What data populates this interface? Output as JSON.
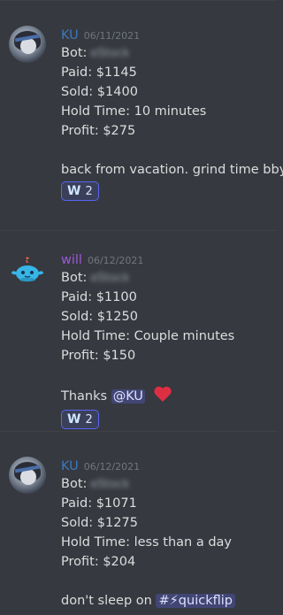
{
  "messages": [
    {
      "author": "KU",
      "timestamp": "06/11/2021",
      "lines": [
        "Bot:",
        "Paid: $1145",
        "Sold: $1400",
        "Hold Time: 10 minutes",
        "Profit: $275"
      ],
      "bot_redacted": "eStock",
      "note": "back from vacation. grind time bby",
      "reaction": {
        "emoji": "W",
        "count": "2"
      }
    },
    {
      "author": "will",
      "timestamp": "06/12/2021",
      "lines": [
        "Bot:",
        "Paid: $1100",
        "Sold: $1250",
        "Hold Time: Couple minutes",
        "Profit: $150"
      ],
      "bot_redacted": "eStock",
      "note_prefix": "Thanks",
      "mention": "@KU",
      "reaction": {
        "emoji": "W",
        "count": "2"
      }
    },
    {
      "author": "KU",
      "timestamp": "06/12/2021",
      "lines": [
        "Bot:",
        "Paid: $1071",
        "Sold: $1275",
        "Hold Time: less than a day",
        "Profit: $204"
      ],
      "bot_redacted": "eStock",
      "note_prefix": "don't sleep on",
      "channel": "#⚡quickflip"
    }
  ],
  "colors": {
    "author_ku": "#3c78bd",
    "author_will": "#9b59d6",
    "background": "#36393f",
    "reaction_border": "#5865f2"
  }
}
